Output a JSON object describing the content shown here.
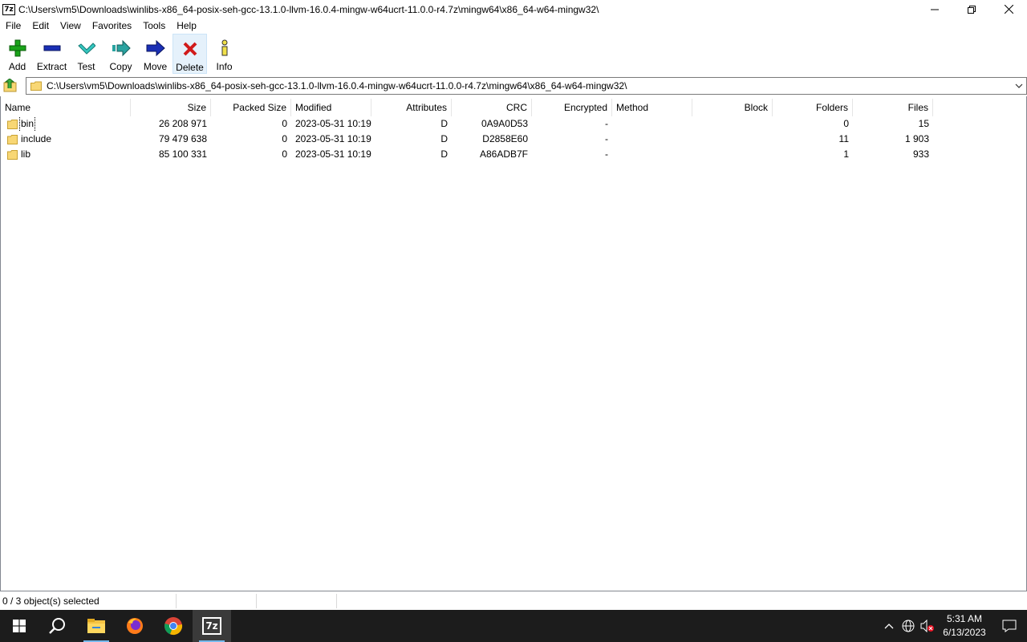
{
  "window": {
    "title": "C:\\Users\\vm5\\Downloads\\winlibs-x86_64-posix-seh-gcc-13.1.0-llvm-16.0.4-mingw-w64ucrt-11.0.0-r4.7z\\mingw64\\x86_64-w64-mingw32\\",
    "app_icon_text": "7z"
  },
  "menu": [
    "File",
    "Edit",
    "View",
    "Favorites",
    "Tools",
    "Help"
  ],
  "toolbar": {
    "add": "Add",
    "extract": "Extract",
    "test": "Test",
    "copy": "Copy",
    "move": "Move",
    "delete": "Delete",
    "info": "Info"
  },
  "address": {
    "path": "C:\\Users\\vm5\\Downloads\\winlibs-x86_64-posix-seh-gcc-13.1.0-llvm-16.0.4-mingw-w64ucrt-11.0.0-r4.7z\\mingw64\\x86_64-w64-mingw32\\"
  },
  "columns": {
    "name": "Name",
    "size": "Size",
    "packed": "Packed Size",
    "modified": "Modified",
    "attributes": "Attributes",
    "crc": "CRC",
    "encrypted": "Encrypted",
    "method": "Method",
    "block": "Block",
    "folders": "Folders",
    "files": "Files"
  },
  "rows": [
    {
      "name": "bin",
      "size": "26 208 971",
      "packed": "0",
      "modified": "2023-05-31 10:19",
      "attributes": "D",
      "crc": "0A9A0D53",
      "encrypted": "-",
      "method": "",
      "block": "",
      "folders": "0",
      "files": "15"
    },
    {
      "name": "include",
      "size": "79 479 638",
      "packed": "0",
      "modified": "2023-05-31 10:19",
      "attributes": "D",
      "crc": "D2858E60",
      "encrypted": "-",
      "method": "",
      "block": "",
      "folders": "11",
      "files": "1 903"
    },
    {
      "name": "lib",
      "size": "85 100 331",
      "packed": "0",
      "modified": "2023-05-31 10:19",
      "attributes": "D",
      "crc": "A86ADB7F",
      "encrypted": "-",
      "method": "",
      "block": "",
      "folders": "1",
      "files": "933"
    }
  ],
  "status": {
    "selection": "0 / 3 object(s) selected",
    "pane2": "",
    "pane3": ""
  },
  "taskbar": {
    "time": "5:31 AM",
    "date": "6/13/2023",
    "app_7z_label": "7z"
  },
  "colors": {
    "folder": "#f8d775",
    "taskbar": "#1c1c1c",
    "accent": "#76b9ed"
  }
}
